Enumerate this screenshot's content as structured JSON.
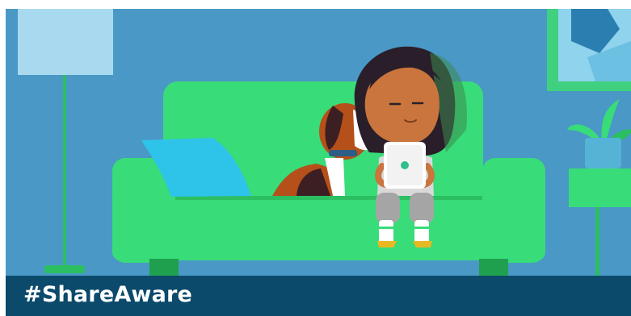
{
  "caption": {
    "hashtag": "#ShareAware"
  },
  "scene": {
    "description_icons": [
      "floor-lamp",
      "sofa",
      "cushion",
      "dog",
      "girl",
      "tablet",
      "framed-picture",
      "potted-plant",
      "side-table"
    ]
  },
  "colors": {
    "wall": "#4a98c6",
    "sofa": "#38dc78",
    "sofa_shade": "#2bbf62",
    "caption_bar": "#0b4a6b",
    "caption_text": "#ffffff",
    "cushion": "#2ec4ea",
    "lamp_shade": "#a8d9ee",
    "picture_frame": "#3fd17f"
  }
}
